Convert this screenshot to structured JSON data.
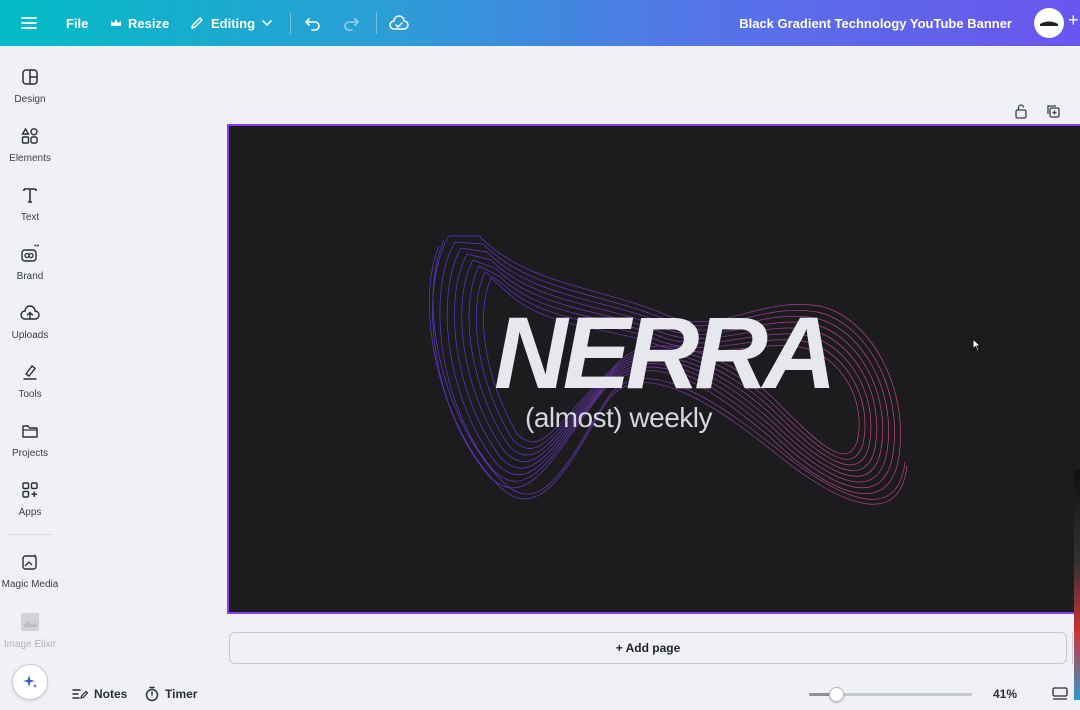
{
  "topbar": {
    "file_label": "File",
    "resize_label": "Resize",
    "editing_label": "Editing",
    "document_title": "Black Gradient Technology YouTube Banner"
  },
  "sidebar": {
    "items": [
      {
        "label": "Design",
        "icon": "layout-icon"
      },
      {
        "label": "Elements",
        "icon": "shapes-icon"
      },
      {
        "label": "Text",
        "icon": "text-icon"
      },
      {
        "label": "Brand",
        "icon": "brand-icon"
      },
      {
        "label": "Uploads",
        "icon": "cloud-upload-icon"
      },
      {
        "label": "Tools",
        "icon": "pen-icon"
      },
      {
        "label": "Projects",
        "icon": "folder-icon"
      },
      {
        "label": "Apps",
        "icon": "apps-grid-icon"
      },
      {
        "label": "Magic Media",
        "icon": "magic-media-icon"
      },
      {
        "label": "Image Elixir",
        "icon": "image-thumb-icon"
      }
    ]
  },
  "canvas": {
    "brand_name": "NERRA",
    "tagline": "(almost) weekly",
    "background": "#1c1c1e",
    "wave_colors": [
      "#6a3cf0",
      "#e0508f"
    ]
  },
  "add_page_label": "+ Add page",
  "bottombar": {
    "notes_label": "Notes",
    "timer_label": "Timer",
    "zoom_value": 0.41,
    "zoom_label": "41%"
  },
  "colors": {
    "accent": "#8b3dff",
    "topbar_start": "#03bbc6",
    "topbar_end": "#6a55ee"
  }
}
